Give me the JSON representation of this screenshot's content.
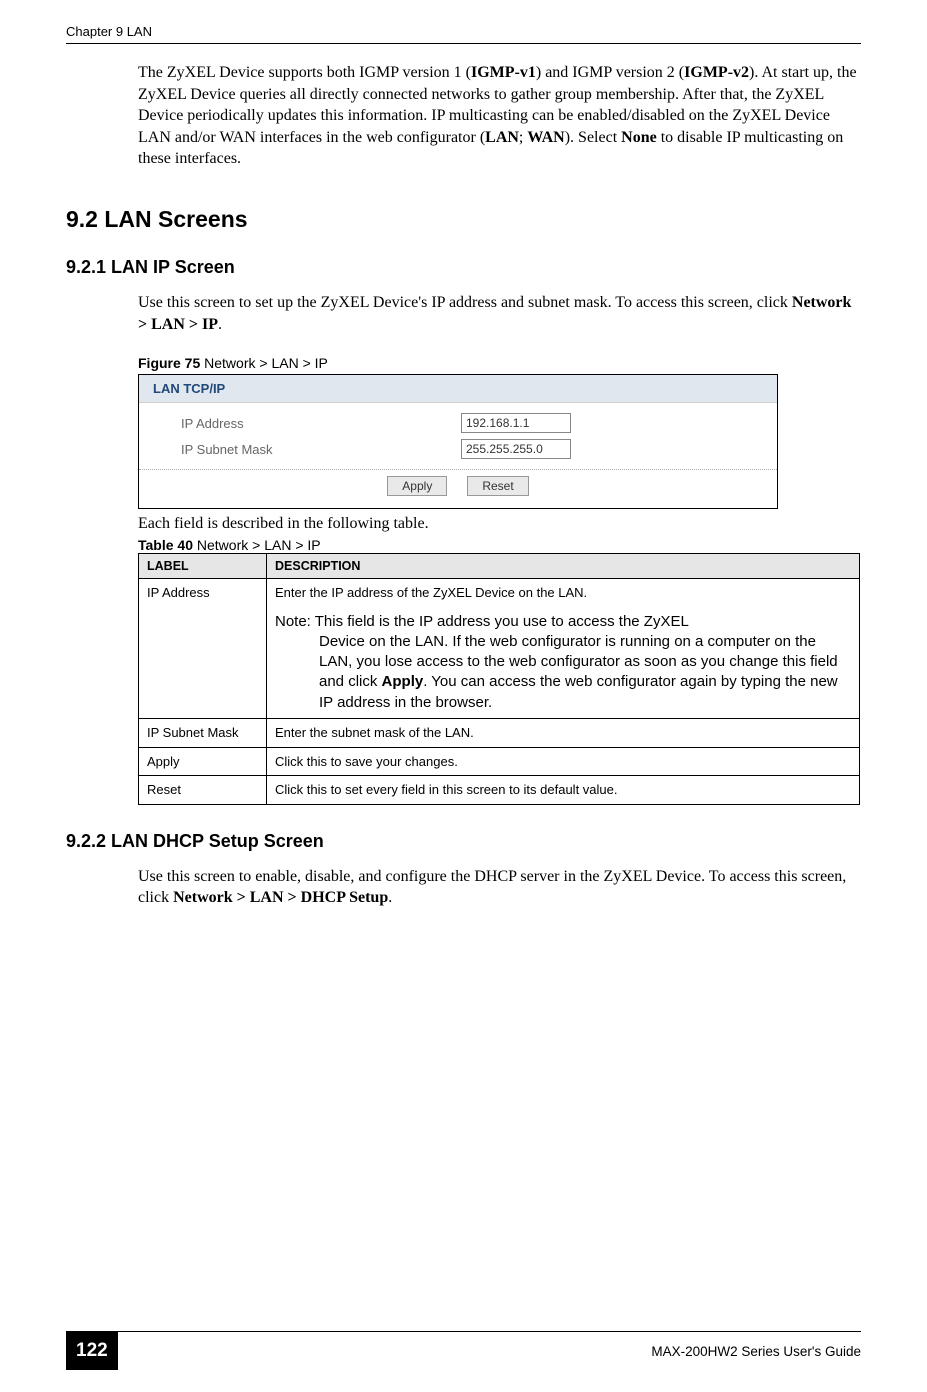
{
  "header": {
    "chapter": "Chapter 9 LAN"
  },
  "paragraphs": {
    "intro": "The ZyXEL Device supports both IGMP version 1 (IGMP-v1) and IGMP version 2 (IGMP-v2). At start up, the ZyXEL Device queries all directly connected networks to gather group membership. After that, the ZyXEL Device periodically updates this information. IP multicasting can be enabled/disabled on the ZyXEL Device LAN and/or WAN interfaces in the web configurator (LAN; WAN). Select None to disable IP multicasting on these interfaces.",
    "lan_ip_intro_a": "Use this screen to set up the ZyXEL Device's IP address and subnet mask. To access this screen, click ",
    "lan_ip_intro_b": "Network > LAN > IP",
    "lan_ip_intro_c": ".",
    "table_intro": "Each field is described in the following table.",
    "dhcp_intro_a": "Use this screen to enable, disable, and configure the DHCP server in the ZyXEL Device. To access this screen, click ",
    "dhcp_intro_b": "Network > LAN > DHCP Setup",
    "dhcp_intro_c": "."
  },
  "sections": {
    "h2": "9.2  LAN Screens",
    "h3_1": "9.2.1  LAN IP Screen",
    "h3_2": "9.2.2  LAN DHCP Setup Screen"
  },
  "figure": {
    "caption_bold": "Figure 75   ",
    "caption": "Network > LAN > IP",
    "panel_title": "LAN TCP/IP",
    "row1_label": "IP Address",
    "row1_value": "192.168.1.1",
    "row2_label": "IP Subnet Mask",
    "row2_value": "255.255.255.0",
    "btn_apply": "Apply",
    "btn_reset": "Reset"
  },
  "table": {
    "caption_bold": "Table 40   ",
    "caption": "Network > LAN > IP",
    "header_label": "LABEL",
    "header_desc": "DESCRIPTION",
    "rows": [
      {
        "label": "IP Address",
        "desc_line1": "Enter the IP address of the ZyXEL Device on the LAN.",
        "note_prefix": "Note: ",
        "note_body": "This field is the IP address you use to access the ZyXEL Device on the LAN. If the web configurator is running on a computer on the LAN, you lose access to the web configurator as soon as you change this field and click Apply. You can access the web configurator again by typing the new IP address in the browser."
      },
      {
        "label": "IP Subnet Mask",
        "desc": "Enter the subnet mask of the LAN."
      },
      {
        "label": "Apply",
        "desc": "Click this to save your changes."
      },
      {
        "label": "Reset",
        "desc": "Click this to set every field in this screen to its default value."
      }
    ]
  },
  "footer": {
    "page": "122",
    "guide": "MAX-200HW2 Series User's Guide"
  }
}
